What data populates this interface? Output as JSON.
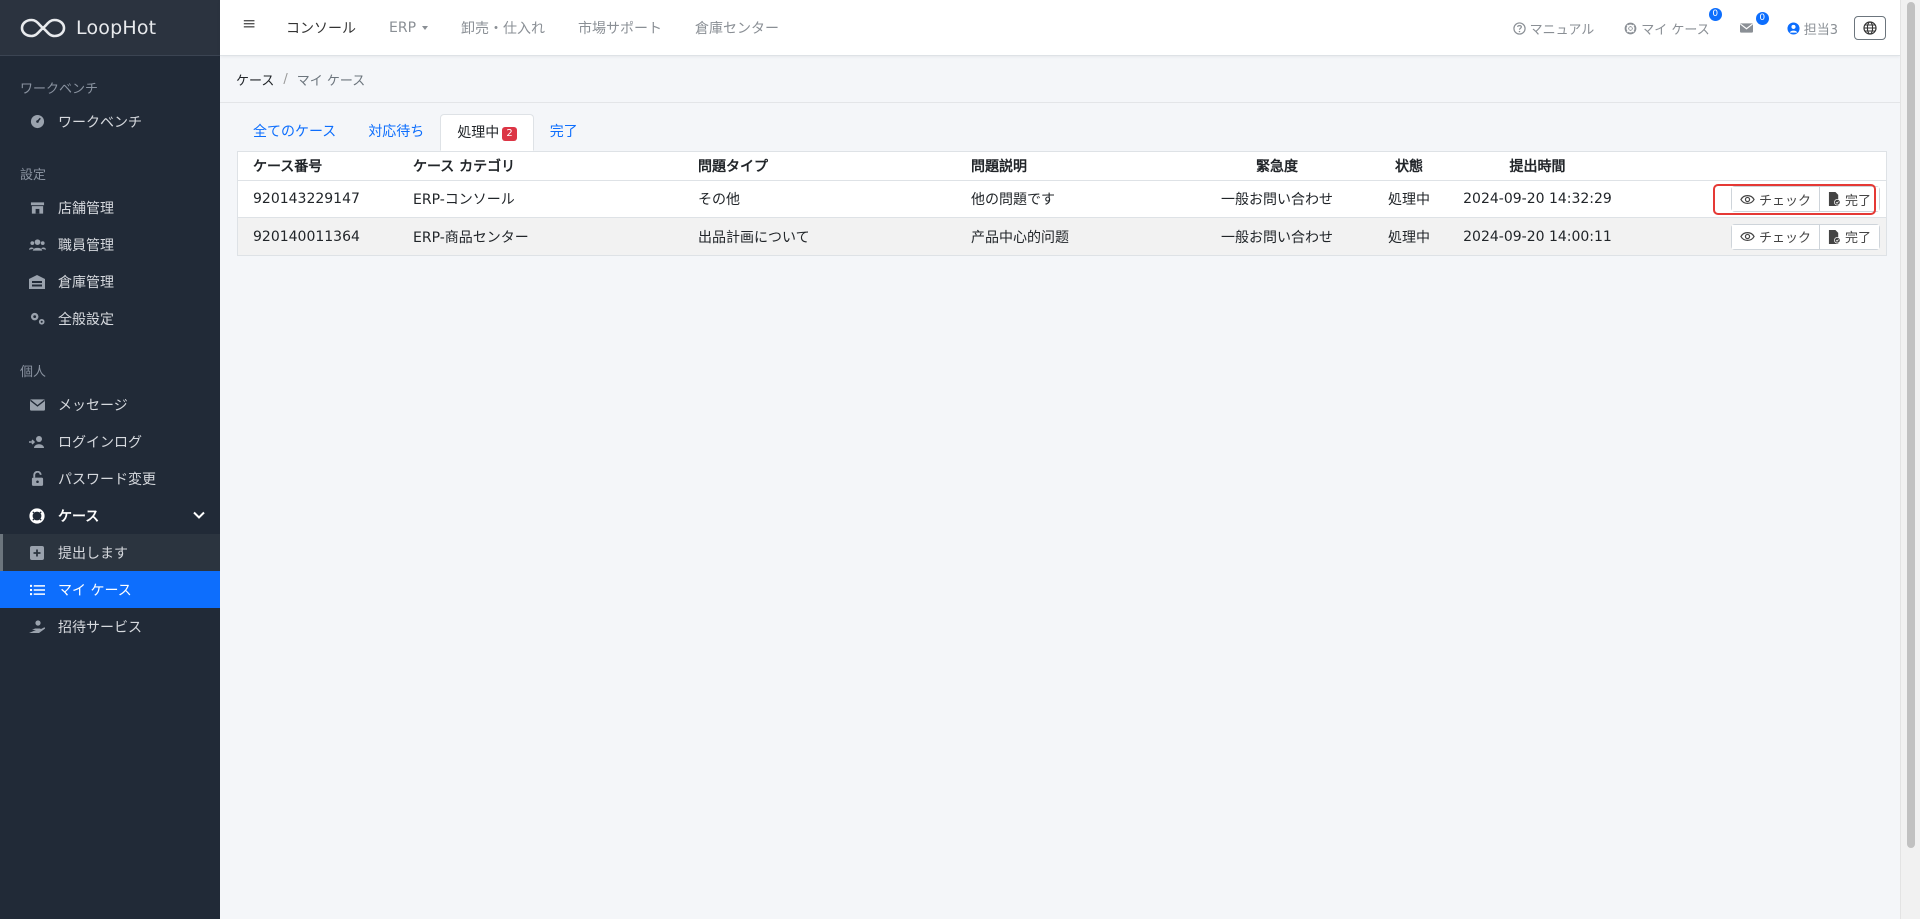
{
  "brand": {
    "name": "LoopHot"
  },
  "sidebar": {
    "sections": [
      {
        "label": "ワークベンチ",
        "items": [
          {
            "label": "ワークベンチ",
            "icon": "dashboard-icon"
          }
        ]
      },
      {
        "label": "設定",
        "items": [
          {
            "label": "店舗管理",
            "icon": "store-icon"
          },
          {
            "label": "職員管理",
            "icon": "users-icon"
          },
          {
            "label": "倉庫管理",
            "icon": "warehouse-icon"
          },
          {
            "label": "全般設定",
            "icon": "gears-icon"
          }
        ]
      },
      {
        "label": "個人",
        "items": [
          {
            "label": "メッセージ",
            "icon": "envelope-icon"
          },
          {
            "label": "ログインログ",
            "icon": "login-log-icon"
          },
          {
            "label": "パスワード変更",
            "icon": "unlock-icon"
          },
          {
            "label": "ケース",
            "icon": "lifebuoy-icon"
          },
          {
            "label": "提出します",
            "icon": "plus-square-icon"
          },
          {
            "label": "マイ ケース",
            "icon": "list-icon"
          },
          {
            "label": "招待サービス",
            "icon": "hand-holding-icon"
          }
        ]
      }
    ]
  },
  "topbar": {
    "menu": [
      {
        "label": "コンソール",
        "active": true
      },
      {
        "label": "ERP",
        "dropdown": true
      },
      {
        "label": "卸売・仕入れ"
      },
      {
        "label": "市場サポート"
      },
      {
        "label": "倉庫センター"
      }
    ],
    "manual": "マニュアル",
    "my_case": "マイ ケース",
    "my_case_badge": "0",
    "mail_badge": "0",
    "user": "担当3"
  },
  "breadcrumb": {
    "root": "ケース",
    "sep": "/",
    "current": "マイ ケース"
  },
  "tabs": [
    {
      "label": "全てのケース"
    },
    {
      "label": "対応待ち"
    },
    {
      "label": "処理中",
      "badge": "2",
      "active": true
    },
    {
      "label": "完了"
    }
  ],
  "table": {
    "headers": [
      "ケース番号",
      "ケース カテゴリ",
      "問題タイプ",
      "問題説明",
      "緊急度",
      "状態",
      "提出時間"
    ],
    "rows": [
      [
        "920143229147",
        "ERP-コンソール",
        "その他",
        "他の問題です",
        "一般お問い合わせ",
        "処理中",
        "2024-09-20 14:32:29"
      ],
      [
        "920140011364",
        "ERP-商品センター",
        "出品計画について",
        "产品中心的问题",
        "一般お問い合わせ",
        "処理中",
        "2024-09-20 14:00:11"
      ]
    ],
    "actions": {
      "check": "チェック",
      "complete": "完了"
    }
  },
  "colors": {
    "sidebar_bg": "#212a37",
    "accent": "#0d6efd",
    "badge_red": "#dc3545",
    "highlight": "#e53935"
  }
}
